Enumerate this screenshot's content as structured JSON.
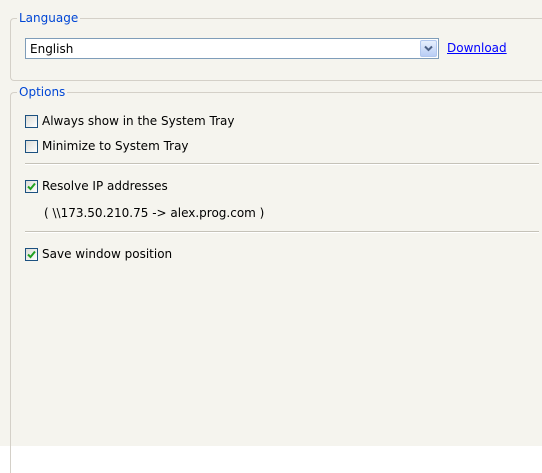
{
  "language_group": {
    "title": "Language",
    "selected_language": "English",
    "download_link": "Download"
  },
  "options_group": {
    "title": "Options",
    "always_show_tray": {
      "label": "Always show in the System Tray",
      "checked": false
    },
    "minimize_to_tray": {
      "label": "Minimize to System Tray",
      "checked": false
    },
    "resolve_ip": {
      "label": "Resolve IP addresses",
      "checked": true
    },
    "resolve_ip_example": "( \\\\173.50.210.75 -> alex.prog.com )",
    "save_window_position": {
      "label": "Save window position",
      "checked": true
    }
  },
  "colors": {
    "group_title": "#0046d5",
    "checkmark": "#21a121",
    "link": "#0000ff"
  },
  "icons": {
    "combo_arrow": "chevron-down-icon",
    "check": "checkmark-icon"
  }
}
